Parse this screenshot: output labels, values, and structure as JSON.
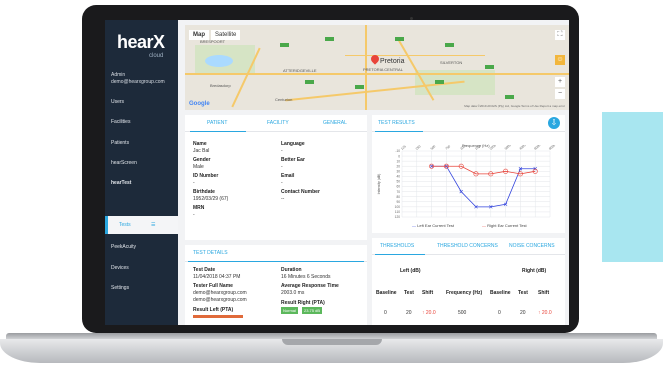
{
  "brand": {
    "logo": "hearX",
    "sub": "cloud"
  },
  "user": {
    "name": "Admin",
    "email": "demo@hearxgroup.com"
  },
  "nav": {
    "users": "Users",
    "facilities": "Facilities",
    "patients": "Patients",
    "hearscreen": "hearScreen",
    "heartest": "hearTest",
    "tests": "Tests",
    "peakacuity": "PeekAcuity",
    "devices": "Devices",
    "settings": "Settings"
  },
  "map": {
    "tab_map": "Map",
    "tab_satellite": "Satellite",
    "city": "Pretoria",
    "towns": [
      "BRESPOORT",
      "ATTERIDGEVILLE",
      "Bredasdorp",
      "Centurion",
      "PRETORIA CENTRAL",
      "SILVERTON"
    ],
    "provider": "Google",
    "footer": "Map data ©2019 AfriGIS (Pty) Ltd, Google   Terms of Use   Report a map error"
  },
  "patient_tabs": {
    "patient": "PATIENT",
    "facility": "FACILITY",
    "general": "GENERAL"
  },
  "patient": {
    "name_label": "Name",
    "name": "Jac Bal",
    "language_label": "Language",
    "language": "-",
    "gender_label": "Gender",
    "gender": "Male",
    "better_ear_label": "Better Ear",
    "better_ear": "-",
    "id_label": "ID Number",
    "id": "-",
    "email_label": "Email",
    "email": "-",
    "birth_label": "Birthdate",
    "birth": "1952/03/29 (67)",
    "contact_label": "Contact Number",
    "contact": "--",
    "mrn_label": "MRN",
    "mrn": "-"
  },
  "test_results": {
    "tab": "TEST RESULTS",
    "download_icon": "download-icon"
  },
  "chart_data": {
    "type": "line",
    "title": "Frequency (Hz)",
    "ylabel": "Intensity (dB)",
    "categories": [
      "125",
      "250",
      "500",
      "750",
      "1000",
      "1500",
      "2000",
      "3000",
      "4000",
      "6000",
      "8000"
    ],
    "y_ticks": [
      "-10",
      "0",
      "10",
      "20",
      "30",
      "40",
      "50",
      "60",
      "70",
      "80",
      "90",
      "100",
      "110",
      "120"
    ],
    "ylim": [
      -10,
      120
    ],
    "series": [
      {
        "name": "Left Ear Current Test",
        "color": "#3344dd",
        "values": [
          null,
          null,
          20,
          20,
          70,
          100,
          100,
          95,
          25,
          25,
          null
        ]
      },
      {
        "name": "Right Ear Current Test",
        "color": "#e8443a",
        "values": [
          null,
          null,
          20,
          20,
          20,
          35,
          35,
          30,
          35,
          30,
          null
        ]
      }
    ],
    "grid": true,
    "legend": "bottom"
  },
  "test_details": {
    "tab": "TEST DETAILS",
    "date_label": "Test Date",
    "date": "11/04/2018 04:37 PM",
    "duration_label": "Duration",
    "duration": "16 Minutes 6 Seconds",
    "tester_label": "Tester Full Name",
    "tester": "demo@hearxgroup.com",
    "avg_label": "Average Response Time",
    "avg": "2003.0 ms",
    "tester_email": "demo@hearxgroup.com",
    "result_right_label": "Result Right (PTA)",
    "result_right_status": "Normal",
    "result_right_value": "23.75 dB",
    "result_left_label": "Result Left (PTA)"
  },
  "thresholds": {
    "tabs": [
      "THRESHOLDS",
      "THRESHOLD CONCERNS",
      "NOISE CONCERNS"
    ],
    "left": "Left (dB)",
    "right": "Right (dB)",
    "headers": [
      "Baseline",
      "Test",
      "Shift",
      "Frequency (Hz)",
      "Baseline",
      "Test",
      "Shift"
    ],
    "row": [
      "0",
      "20",
      "↑ 20.0",
      "500",
      "0",
      "20",
      "↑ 20.0"
    ]
  }
}
